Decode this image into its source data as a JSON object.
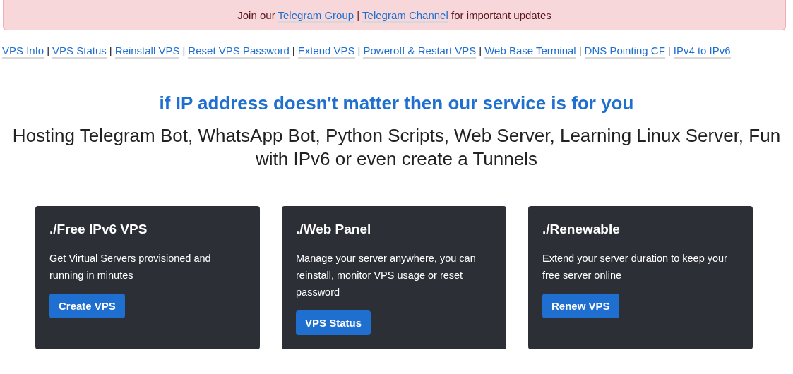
{
  "alert": {
    "prefix": "Join our",
    "links": [
      "Telegram Group",
      "Telegram Channel"
    ],
    "separator": "|",
    "suffix": "for important updates"
  },
  "nav": [
    {
      "kind": "link",
      "text": "VPS Info"
    },
    {
      "kind": "separator",
      "text": "|"
    },
    {
      "kind": "link",
      "text": "VPS Status"
    },
    {
      "kind": "separator",
      "text": "|"
    },
    {
      "kind": "link",
      "text": "Reinstall VPS"
    },
    {
      "kind": "separator",
      "text": "|"
    },
    {
      "kind": "link",
      "text": "Reset VPS Password"
    },
    {
      "kind": "separator",
      "text": "|"
    },
    {
      "kind": "link",
      "text": "Extend VPS"
    },
    {
      "kind": "separator",
      "text": "|"
    },
    {
      "kind": "link",
      "text": "Poweroff & Restart VPS"
    },
    {
      "kind": "separator",
      "text": "|"
    },
    {
      "kind": "link",
      "text": "Web Base Terminal"
    },
    {
      "kind": "separator",
      "text": "|"
    },
    {
      "kind": "link",
      "text": "DNS Pointing CF"
    },
    {
      "kind": "separator",
      "text": "|"
    },
    {
      "kind": "link",
      "text": "IPv4 to IPv6"
    }
  ],
  "tagline": "if IP address doesn't matter then our service is for you",
  "subtitle": "Hosting Telegram Bot, WhatsApp Bot, Python Scripts, Web Server, Learning Linux Server, Fun with IPv6 or even create a Tunnels",
  "cards": [
    {
      "title": "./Free IPv6 VPS",
      "text": "Get Virtual Servers provisioned and running in minutes",
      "button": "Create VPS"
    },
    {
      "title": "./Web Panel",
      "text": "Manage your server anywhere, you can reinstall, monitor VPS usage or reset password",
      "button": "VPS Status"
    },
    {
      "title": "./Renewable",
      "text": "Extend your server duration to keep your free server online",
      "button": "Renew VPS"
    }
  ]
}
